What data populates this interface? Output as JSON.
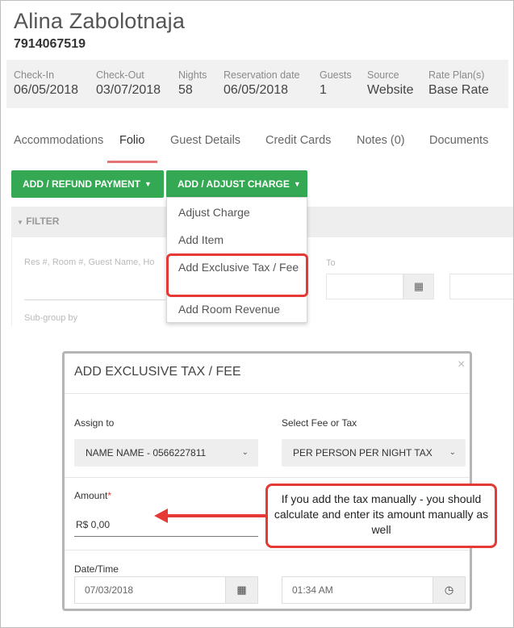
{
  "guest": {
    "name": "Alina Zabolotnaja",
    "phone": "7914067519"
  },
  "reservation": [
    {
      "label": "Check-In",
      "value": "06/05/2018"
    },
    {
      "label": "Check-Out",
      "value": "03/07/2018"
    },
    {
      "label": "Nights",
      "value": "58"
    },
    {
      "label": "Reservation date",
      "value": "06/05/2018"
    },
    {
      "label": "Guests",
      "value": "1"
    },
    {
      "label": "Source",
      "value": "Website"
    },
    {
      "label": "Rate Plan(s)",
      "value": "Base Rate"
    }
  ],
  "tabs": [
    "Accommodations",
    "Folio",
    "Guest Details",
    "Credit Cards",
    "Notes (0)",
    "Documents"
  ],
  "active_tab": "Folio",
  "toolbar": {
    "refund_label": "ADD / REFUND PAYMENT",
    "charge_label": "ADD / ADJUST CHARGE"
  },
  "charge_menu": [
    "Adjust Charge",
    "Add Item",
    "Add Exclusive Tax / Fee",
    "Add Room Revenue"
  ],
  "filter": {
    "title": "FILTER",
    "placeholder": "Res #, Room #, Guest Name, Ho",
    "to_label": "To",
    "subgroup_label": "Sub-group by"
  },
  "modal": {
    "title": "ADD EXCLUSIVE TAX / FEE",
    "assign_label": "Assign to",
    "assign_value": "NAME NAME - 0566227811",
    "fee_label": "Select Fee or Tax",
    "fee_value": "PER PERSON PER NIGHT TAX",
    "amount_label": "Amount",
    "amount_value": "R$ 0,00",
    "datetime_label": "Date/Time",
    "date_value": "07/03/2018",
    "time_value": "01:34 AM"
  },
  "callout": {
    "text": "If you add the tax manually - you should calculate and enter its amount manually as well"
  },
  "colors": {
    "accent_green": "#34a853",
    "highlight_red": "#e53935",
    "tab_underline": "#e57373"
  },
  "icons": {
    "caret": "caret-down-icon",
    "calendar": "calendar-icon",
    "clock": "clock-icon",
    "close": "close-icon"
  }
}
